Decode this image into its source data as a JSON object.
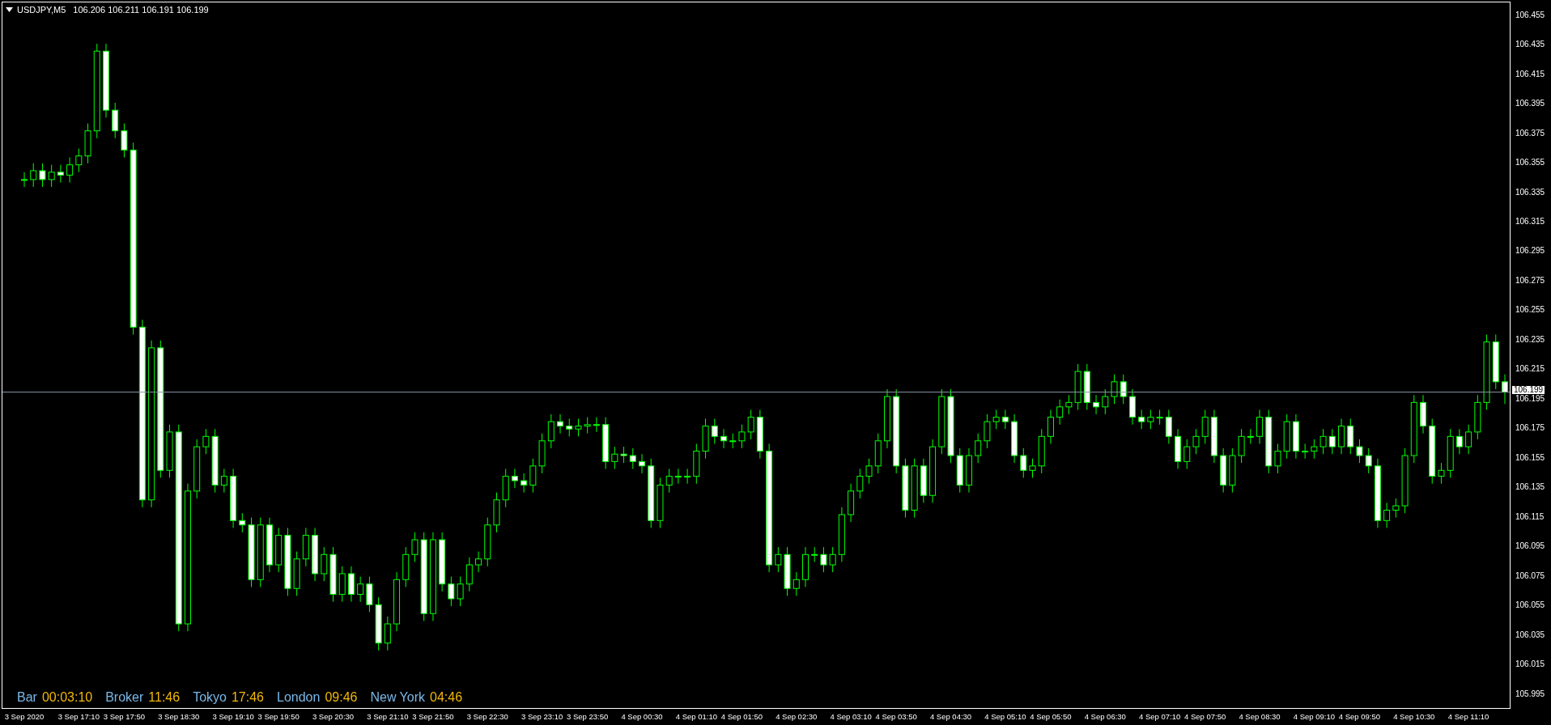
{
  "header": {
    "symbol": "USDJPY,M5",
    "ohlc": [
      "106.206",
      "106.211",
      "106.191",
      "106.199"
    ]
  },
  "clock": [
    {
      "label": "Bar",
      "value": "00:03:10"
    },
    {
      "label": "Broker",
      "value": "11:46"
    },
    {
      "label": "Tokyo",
      "value": "17:46"
    },
    {
      "label": "London",
      "value": "09:46"
    },
    {
      "label": "New York",
      "value": "04:46"
    }
  ],
  "chart_data": {
    "type": "candlestick",
    "ylim": [
      105.985,
      106.463
    ],
    "categories": [
      "3 Sep 2020",
      null,
      null,
      null,
      null,
      null,
      "3 Sep 17:10",
      null,
      null,
      null,
      null,
      "3 Sep 17:50",
      null,
      null,
      null,
      null,
      null,
      "3 Sep 18:30",
      null,
      null,
      null,
      null,
      null,
      "3 Sep 19:10",
      null,
      null,
      null,
      null,
      "3 Sep 19:50",
      null,
      null,
      null,
      null,
      null,
      "3 Sep 20:30",
      null,
      null,
      null,
      null,
      null,
      "3 Sep 21:10",
      null,
      null,
      null,
      null,
      "3 Sep 21:50",
      null,
      null,
      null,
      null,
      null,
      "3 Sep 22:30",
      null,
      null,
      null,
      null,
      null,
      "3 Sep 23:10",
      null,
      null,
      null,
      null,
      "3 Sep 23:50",
      null,
      null,
      null,
      null,
      null,
      "4 Sep 00:30",
      null,
      null,
      null,
      null,
      null,
      "4 Sep 01:10",
      null,
      null,
      null,
      null,
      "4 Sep 01:50",
      null,
      null,
      null,
      null,
      null,
      "4 Sep 02:30",
      null,
      null,
      null,
      null,
      null,
      "4 Sep 03:10",
      null,
      null,
      null,
      null,
      "4 Sep 03:50",
      null,
      null,
      null,
      null,
      null,
      "4 Sep 04:30",
      null,
      null,
      null,
      null,
      null,
      "4 Sep 05:10",
      null,
      null,
      null,
      null,
      "4 Sep 05:50",
      null,
      null,
      null,
      null,
      null,
      "4 Sep 06:30",
      null,
      null,
      null,
      null,
      null,
      "4 Sep 07:10",
      null,
      null,
      null,
      null,
      "4 Sep 07:50",
      null,
      null,
      null,
      null,
      null,
      "4 Sep 08:30",
      null,
      null,
      null,
      null,
      null,
      "4 Sep 09:10",
      null,
      null,
      null,
      null,
      "4 Sep 09:50",
      null,
      null,
      null,
      null,
      null,
      "4 Sep 10:30",
      null,
      null,
      null,
      null,
      null,
      "4 Sep 11:10",
      null,
      null,
      null,
      null
    ],
    "ohlc": [
      [
        106.343,
        106.348,
        106.338,
        106.343
      ],
      [
        106.343,
        106.354,
        106.338,
        106.349
      ],
      [
        106.349,
        106.354,
        106.338,
        106.343
      ],
      [
        106.343,
        106.353,
        106.338,
        106.348
      ],
      [
        106.348,
        106.353,
        106.341,
        106.346
      ],
      [
        106.346,
        106.358,
        106.341,
        106.353
      ],
      [
        106.353,
        106.364,
        106.348,
        106.359
      ],
      [
        106.359,
        106.381,
        106.354,
        106.376
      ],
      [
        106.376,
        106.435,
        106.371,
        106.43
      ],
      [
        106.43,
        106.435,
        106.385,
        106.39
      ],
      [
        106.39,
        106.395,
        106.371,
        106.376
      ],
      [
        106.376,
        106.381,
        106.358,
        106.363
      ],
      [
        106.363,
        106.368,
        106.238,
        106.243
      ],
      [
        106.243,
        106.248,
        106.121,
        106.126
      ],
      [
        106.126,
        106.234,
        106.121,
        106.229
      ],
      [
        106.229,
        106.234,
        106.141,
        106.146
      ],
      [
        106.146,
        106.177,
        106.141,
        106.172
      ],
      [
        106.172,
        106.177,
        106.037,
        106.042
      ],
      [
        106.042,
        106.137,
        106.037,
        106.132
      ],
      [
        106.132,
        106.167,
        106.127,
        106.162
      ],
      [
        106.162,
        106.174,
        106.157,
        106.169
      ],
      [
        106.169,
        106.174,
        106.131,
        106.136
      ],
      [
        106.136,
        106.147,
        106.131,
        106.142
      ],
      [
        106.142,
        106.147,
        106.107,
        106.112
      ],
      [
        106.112,
        106.117,
        106.104,
        106.109
      ],
      [
        106.109,
        106.114,
        106.067,
        106.072
      ],
      [
        106.072,
        106.114,
        106.067,
        106.109
      ],
      [
        106.109,
        106.114,
        106.077,
        106.082
      ],
      [
        106.082,
        106.107,
        106.077,
        106.102
      ],
      [
        106.102,
        106.107,
        106.061,
        106.066
      ],
      [
        106.066,
        106.091,
        106.061,
        106.086
      ],
      [
        106.086,
        106.107,
        106.081,
        106.102
      ],
      [
        106.102,
        106.107,
        106.071,
        106.076
      ],
      [
        106.076,
        106.094,
        106.071,
        106.089
      ],
      [
        106.089,
        106.094,
        106.057,
        106.062
      ],
      [
        106.062,
        106.081,
        106.057,
        106.076
      ],
      [
        106.076,
        106.081,
        106.057,
        106.062
      ],
      [
        106.062,
        106.074,
        106.057,
        106.069
      ],
      [
        106.069,
        106.074,
        106.05,
        106.055
      ],
      [
        106.055,
        106.06,
        106.024,
        106.029
      ],
      [
        106.029,
        106.047,
        106.024,
        106.042
      ],
      [
        106.042,
        106.077,
        106.037,
        106.072
      ],
      [
        106.072,
        106.094,
        106.067,
        106.089
      ],
      [
        106.089,
        106.104,
        106.084,
        106.099
      ],
      [
        106.099,
        106.104,
        106.044,
        106.049
      ],
      [
        106.049,
        106.104,
        106.044,
        106.099
      ],
      [
        106.099,
        106.104,
        106.064,
        106.069
      ],
      [
        106.069,
        106.074,
        106.054,
        106.059
      ],
      [
        106.059,
        106.074,
        106.054,
        106.069
      ],
      [
        106.069,
        106.087,
        106.064,
        106.082
      ],
      [
        106.082,
        106.091,
        106.077,
        106.086
      ],
      [
        106.086,
        106.114,
        106.081,
        106.109
      ],
      [
        106.109,
        106.131,
        106.104,
        106.126
      ],
      [
        106.126,
        106.147,
        106.121,
        106.142
      ],
      [
        106.142,
        106.147,
        106.134,
        106.139
      ],
      [
        106.139,
        106.144,
        106.131,
        106.136
      ],
      [
        106.136,
        106.154,
        106.131,
        106.149
      ],
      [
        106.149,
        106.171,
        106.144,
        106.166
      ],
      [
        106.166,
        106.184,
        106.161,
        106.179
      ],
      [
        106.179,
        106.184,
        106.171,
        106.176
      ],
      [
        106.176,
        106.181,
        106.169,
        106.174
      ],
      [
        106.174,
        106.181,
        106.169,
        106.176
      ],
      [
        106.176,
        106.182,
        106.171,
        106.177
      ],
      [
        106.177,
        106.182,
        106.172,
        106.177
      ],
      [
        106.177,
        106.182,
        106.147,
        106.152
      ],
      [
        106.152,
        106.162,
        106.147,
        106.157
      ],
      [
        106.157,
        106.162,
        106.151,
        106.156
      ],
      [
        106.156,
        106.161,
        106.147,
        106.152
      ],
      [
        106.152,
        106.157,
        106.144,
        106.149
      ],
      [
        106.149,
        106.154,
        106.107,
        106.112
      ],
      [
        106.112,
        106.141,
        106.107,
        106.136
      ],
      [
        106.136,
        106.147,
        106.131,
        106.142
      ],
      [
        106.142,
        106.147,
        106.137,
        106.142
      ],
      [
        106.142,
        106.147,
        106.137,
        106.142
      ],
      [
        106.142,
        106.164,
        106.137,
        106.159
      ],
      [
        106.159,
        106.181,
        106.154,
        106.176
      ],
      [
        106.176,
        106.181,
        106.164,
        106.169
      ],
      [
        106.169,
        106.174,
        106.161,
        106.166
      ],
      [
        106.166,
        106.171,
        106.161,
        106.166
      ],
      [
        106.166,
        106.177,
        106.161,
        106.172
      ],
      [
        106.172,
        106.187,
        106.167,
        106.182
      ],
      [
        106.182,
        106.187,
        106.154,
        106.159
      ],
      [
        106.159,
        106.164,
        106.077,
        106.082
      ],
      [
        106.082,
        106.094,
        106.077,
        106.089
      ],
      [
        106.089,
        106.094,
        106.061,
        106.066
      ],
      [
        106.066,
        106.077,
        106.061,
        106.072
      ],
      [
        106.072,
        106.094,
        106.067,
        106.089
      ],
      [
        106.089,
        106.094,
        106.084,
        106.089
      ],
      [
        106.089,
        106.094,
        106.077,
        106.082
      ],
      [
        106.082,
        106.094,
        106.077,
        106.089
      ],
      [
        106.089,
        106.121,
        106.084,
        106.116
      ],
      [
        106.116,
        106.137,
        106.111,
        106.132
      ],
      [
        106.132,
        106.147,
        106.127,
        106.142
      ],
      [
        106.142,
        106.154,
        106.137,
        106.149
      ],
      [
        106.149,
        106.171,
        106.144,
        106.166
      ],
      [
        106.166,
        106.201,
        106.161,
        106.196
      ],
      [
        106.196,
        106.201,
        106.144,
        106.149
      ],
      [
        106.149,
        106.154,
        106.114,
        106.119
      ],
      [
        106.119,
        106.154,
        106.114,
        106.149
      ],
      [
        106.149,
        106.154,
        106.124,
        106.129
      ],
      [
        106.129,
        106.167,
        106.124,
        106.162
      ],
      [
        106.162,
        106.201,
        106.157,
        106.196
      ],
      [
        106.196,
        106.201,
        106.151,
        106.156
      ],
      [
        106.156,
        106.161,
        106.131,
        106.136
      ],
      [
        106.136,
        106.161,
        106.131,
        106.156
      ],
      [
        106.156,
        106.171,
        106.151,
        106.166
      ],
      [
        106.166,
        106.184,
        106.161,
        106.179
      ],
      [
        106.179,
        106.187,
        106.174,
        106.182
      ],
      [
        106.182,
        106.187,
        106.174,
        106.179
      ],
      [
        106.179,
        106.184,
        106.151,
        106.156
      ],
      [
        106.156,
        106.161,
        106.141,
        106.146
      ],
      [
        106.146,
        106.154,
        106.141,
        106.149
      ],
      [
        106.149,
        106.174,
        106.144,
        106.169
      ],
      [
        106.169,
        106.187,
        106.164,
        106.182
      ],
      [
        106.182,
        106.194,
        106.177,
        106.189
      ],
      [
        106.189,
        106.197,
        106.184,
        106.192
      ],
      [
        106.192,
        106.218,
        106.187,
        106.213
      ],
      [
        106.213,
        106.218,
        106.187,
        106.192
      ],
      [
        106.192,
        106.197,
        106.184,
        106.189
      ],
      [
        106.189,
        106.201,
        106.184,
        106.196
      ],
      [
        106.196,
        106.211,
        106.191,
        106.206
      ],
      [
        106.206,
        106.211,
        106.191,
        106.196
      ],
      [
        106.196,
        106.201,
        106.177,
        106.182
      ],
      [
        106.182,
        106.187,
        106.174,
        106.179
      ],
      [
        106.179,
        106.187,
        106.174,
        106.182
      ],
      [
        106.182,
        106.187,
        106.177,
        106.182
      ],
      [
        106.182,
        106.187,
        106.164,
        106.169
      ],
      [
        106.169,
        106.174,
        106.147,
        106.152
      ],
      [
        106.152,
        106.167,
        106.147,
        106.162
      ],
      [
        106.162,
        106.174,
        106.157,
        106.169
      ],
      [
        106.169,
        106.187,
        106.164,
        106.182
      ],
      [
        106.182,
        106.187,
        106.151,
        106.156
      ],
      [
        106.156,
        106.161,
        106.131,
        106.136
      ],
      [
        106.136,
        106.161,
        106.131,
        106.156
      ],
      [
        106.156,
        106.174,
        106.151,
        106.169
      ],
      [
        106.169,
        106.174,
        106.164,
        106.169
      ],
      [
        106.169,
        106.187,
        106.164,
        106.182
      ],
      [
        106.182,
        106.187,
        106.144,
        106.149
      ],
      [
        106.149,
        106.164,
        106.144,
        106.159
      ],
      [
        106.159,
        106.184,
        106.154,
        106.179
      ],
      [
        106.179,
        106.184,
        106.154,
        106.159
      ],
      [
        106.159,
        106.164,
        106.154,
        106.159
      ],
      [
        106.159,
        106.167,
        106.154,
        106.162
      ],
      [
        106.162,
        106.174,
        106.157,
        106.169
      ],
      [
        106.169,
        106.174,
        106.157,
        106.162
      ],
      [
        106.162,
        106.181,
        106.157,
        106.176
      ],
      [
        106.176,
        106.181,
        106.157,
        106.162
      ],
      [
        106.162,
        106.167,
        106.151,
        106.156
      ],
      [
        106.156,
        106.161,
        106.144,
        106.149
      ],
      [
        106.149,
        106.154,
        106.107,
        106.112
      ],
      [
        106.112,
        106.124,
        106.107,
        106.119
      ],
      [
        106.119,
        106.127,
        106.114,
        106.122
      ],
      [
        106.122,
        106.161,
        106.117,
        106.156
      ],
      [
        106.156,
        106.197,
        106.151,
        106.192
      ],
      [
        106.192,
        106.197,
        106.171,
        106.176
      ],
      [
        106.176,
        106.181,
        106.137,
        106.142
      ],
      [
        106.142,
        106.151,
        106.137,
        106.146
      ],
      [
        106.146,
        106.174,
        106.141,
        106.169
      ],
      [
        106.169,
        106.174,
        106.157,
        106.162
      ],
      [
        106.162,
        106.177,
        106.157,
        106.172
      ],
      [
        106.172,
        106.197,
        106.167,
        106.192
      ],
      [
        106.192,
        106.238,
        106.187,
        106.233
      ],
      [
        106.233,
        106.238,
        106.201,
        106.206
      ],
      [
        106.206,
        106.211,
        106.191,
        106.199
      ]
    ],
    "yticks": [
      {
        "value": 106.455,
        "label": "106.455"
      },
      {
        "value": 106.435,
        "label": "106.435"
      },
      {
        "value": 106.415,
        "label": "106.415"
      },
      {
        "value": 106.395,
        "label": "106.395"
      },
      {
        "value": 106.375,
        "label": "106.375"
      },
      {
        "value": 106.355,
        "label": "106.355"
      },
      {
        "value": 106.335,
        "label": "106.335"
      },
      {
        "value": 106.315,
        "label": "106.315"
      },
      {
        "value": 106.295,
        "label": "106.295"
      },
      {
        "value": 106.275,
        "label": "106.275"
      },
      {
        "value": 106.255,
        "label": "106.255"
      },
      {
        "value": 106.235,
        "label": "106.235"
      },
      {
        "value": 106.215,
        "label": "106.215"
      },
      {
        "value": 106.195,
        "label": "106.195"
      },
      {
        "value": 106.175,
        "label": "106.175"
      },
      {
        "value": 106.155,
        "label": "106.155"
      },
      {
        "value": 106.135,
        "label": "106.135"
      },
      {
        "value": 106.115,
        "label": "106.115"
      },
      {
        "value": 106.095,
        "label": "106.095"
      },
      {
        "value": 106.075,
        "label": "106.075"
      },
      {
        "value": 106.055,
        "label": "106.055"
      },
      {
        "value": 106.035,
        "label": "106.035"
      },
      {
        "value": 106.015,
        "label": "106.015"
      },
      {
        "value": 105.995,
        "label": "105.995"
      }
    ],
    "ref_lines": [
      {
        "axis": "y",
        "value": 106.199,
        "label": "106.199"
      }
    ]
  }
}
